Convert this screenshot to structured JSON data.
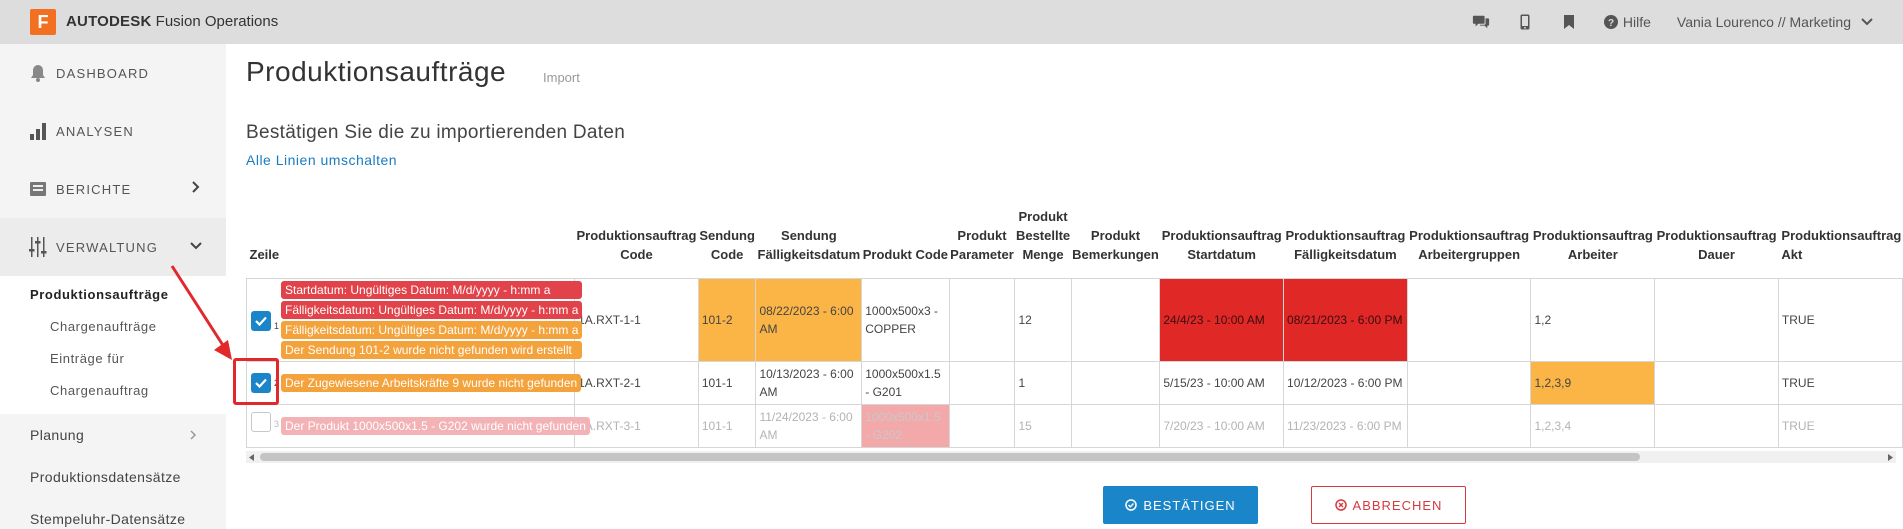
{
  "app": {
    "logo_letter": "F",
    "title_bold": "AUTODESK",
    "title_rest": " Fusion Operations"
  },
  "topbar": {
    "icons": [
      "chat-icon",
      "mobile-icon",
      "bookmark-icon"
    ],
    "help_label": "Hilfe",
    "user_label": "Vania Lourenco // Marketing"
  },
  "sidebar": {
    "main": [
      {
        "label": "DASHBOARD",
        "icon": "bell-icon"
      },
      {
        "label": "ANALYSEN",
        "icon": "bar-chart-icon"
      },
      {
        "label": "BERICHTE",
        "icon": "book-icon"
      },
      {
        "label": "VERWALTUNG",
        "icon": "sliders-icon"
      }
    ],
    "sub": {
      "active": "Produktionsaufträge",
      "items": [
        "Chargenaufträge",
        "Einträge für",
        "Chargenauftrag"
      ]
    },
    "plain": [
      "Planung",
      "Produktionsdatensätze",
      "Stempeluhr-Datensätze"
    ]
  },
  "page": {
    "title": "Produktionsaufträge",
    "subtitle": "Import",
    "confirm_title": "Bestätigen Sie die zu importierenden Daten",
    "toggle_link": "Alle Linien umschalten"
  },
  "table": {
    "headers": [
      "Zeile",
      "Produktionsauftrag Code",
      "Sendung Code",
      "Sendung Fälligkeitsdatum",
      "Produkt Code",
      "Produkt Parameter",
      "Produkt Bestellte Menge",
      "Produkt Bemerkungen",
      "Produktionsauftrag Startdatum",
      "Produktionsauftrag Fälligkeitsdatum",
      "Produktionsauftrag Arbeitergruppen",
      "Produktionsauftrag Arbeiter",
      "Produktionsauftrag Dauer",
      "Produktionsauftrag Akt"
    ],
    "rows": [
      {
        "num": "1",
        "checked": true,
        "errors": [
          {
            "text": "Startdatum: Ungültiges Datum: M/d/yyyy - h:mm a",
            "level": "red"
          },
          {
            "text": "Fälligkeitsdatum: Ungültiges Datum: M/d/yyyy - h:mm a",
            "level": "red"
          },
          {
            "text": "Fälligkeitsdatum: Ungültiges Datum: M/d/yyyy - h:mm a",
            "level": "orange"
          },
          {
            "text": "Der Sendung 101-2 wurde nicht gefunden wird erstellt",
            "level": "orange"
          }
        ],
        "cells": [
          "1A.RXT-1-1",
          "101-2",
          "08/22/2023 - 6:00 AM",
          "1000x500x3 - COPPER",
          "",
          "12",
          "",
          "24/4/23 - 10:00 AM",
          "08/21/2023 - 6:00 PM",
          "",
          "1,2",
          "",
          "TRUE"
        ]
      },
      {
        "num": "2",
        "checked": true,
        "errors": [
          {
            "text": "Der Zugewiesene Arbeitskräfte 9 wurde nicht gefunden",
            "level": "orange"
          }
        ],
        "cells": [
          "1A.RXT-2-1",
          "101-1",
          "10/13/2023 - 6:00 AM",
          "1000x500x1.5 - G201",
          "",
          "1",
          "",
          "5/15/23 - 10:00 AM",
          "10/12/2023 - 6:00 PM",
          "",
          "1,2,3,9",
          "",
          "TRUE"
        ]
      },
      {
        "num": "3",
        "checked": false,
        "errors": [
          {
            "text": "Der Produkt 1000x500x1.5 - G202 wurde nicht gefunden",
            "level": "pink"
          }
        ],
        "cells": [
          "1A.RXT-3-1",
          "101-1",
          "11/24/2023 - 6:00 AM",
          "1000x500x1.5 - G202",
          "",
          "15",
          "",
          "7/20/23 - 10:00 AM",
          "11/23/2023 - 6:00 PM",
          "",
          "1,2,3,4",
          "",
          "TRUE"
        ]
      }
    ]
  },
  "buttons": {
    "confirm": "BESTÄTIGEN",
    "cancel": "ABBRECHEN"
  },
  "colors": {
    "accent": "#1a86c9",
    "warning": "#fbb546",
    "error": "#e02826",
    "brand": "#f37021"
  }
}
